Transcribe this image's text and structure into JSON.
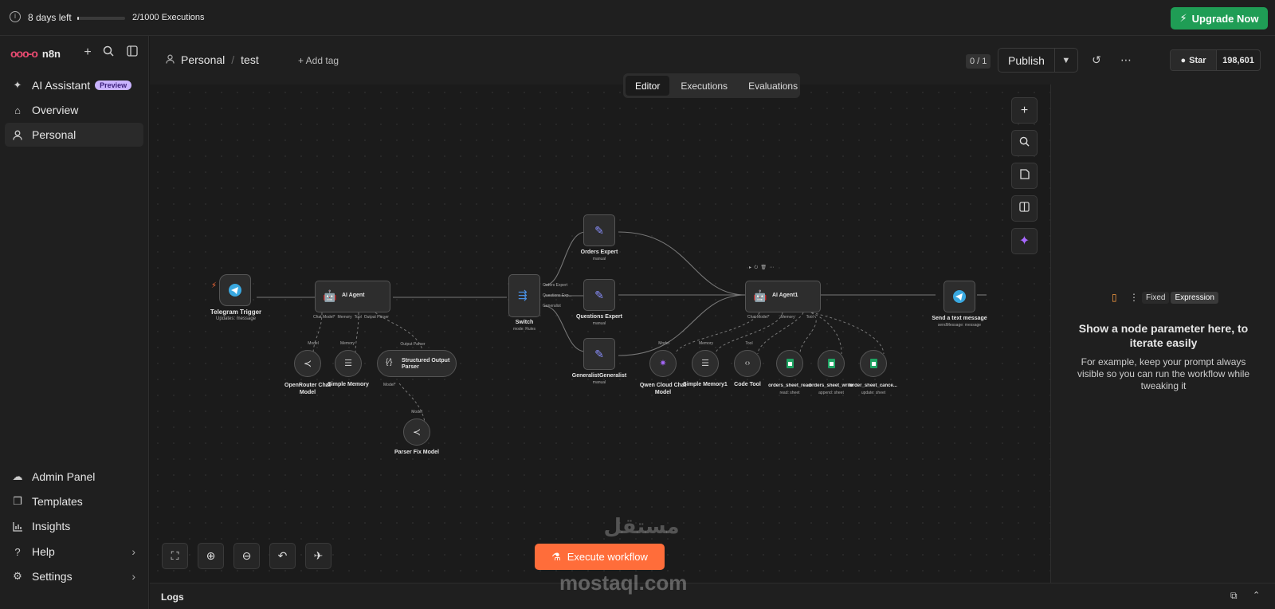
{
  "trial": {
    "days_left": "8 days left",
    "executions": "2/1000 Executions",
    "progress": 0.002
  },
  "upgrade_label": "Upgrade Now",
  "app_name": "n8n",
  "nav": {
    "ai_assistant": "AI Assistant",
    "preview_badge": "Preview",
    "overview": "Overview",
    "personal": "Personal",
    "admin_panel": "Admin Panel",
    "templates": "Templates",
    "insights": "Insights",
    "help": "Help",
    "settings": "Settings"
  },
  "breadcrumb": {
    "project": "Personal",
    "workflow": "test"
  },
  "add_tag": "+ Add tag",
  "tabs": {
    "editor": "Editor",
    "executions": "Executions",
    "evaluations": "Evaluations"
  },
  "version_counter": "0 / 1",
  "publish_label": "Publish",
  "github": {
    "star": "Star",
    "count": "198,601"
  },
  "execute_label": "Execute workflow",
  "logs_label": "Logs",
  "right_panel": {
    "fixed": "Fixed",
    "expression": "Expression",
    "title": "Show a node parameter here, to iterate easily",
    "body": "For example, keep your prompt always visible so you can run the workflow while tweaking it"
  },
  "watermark": {
    "arabic": "مستقل",
    "latin": "mostaql.com"
  },
  "nodes": {
    "telegram_trigger": {
      "title": "Telegram Trigger",
      "sub": "Updates: message"
    },
    "ai_agent": {
      "title": "AI Agent",
      "ports": [
        "Chat Model*",
        "Memory",
        "Tool",
        "Output Parser"
      ]
    },
    "openrouter": {
      "title": "OpenRouter Chat Model",
      "port": "Model"
    },
    "simple_memory": {
      "title": "Simple Memory",
      "port": "Memory"
    },
    "structured_parser": {
      "title": "Structured Output Parser",
      "port_in": "Output Parser",
      "port_out": "Model*"
    },
    "parser_fix": {
      "title": "Parser Fix Model",
      "port": "Model"
    },
    "switch": {
      "title": "Switch",
      "sub": "mode: Rules",
      "outputs": [
        "Orders Expert",
        "Questions Exp...",
        "Generalist"
      ]
    },
    "orders_expert": {
      "title": "Orders Expert",
      "sub": "manual"
    },
    "questions_expert": {
      "title": "Questions Expert",
      "sub": "manual"
    },
    "generalist": {
      "title": "GeneralistGeneralist",
      "sub": "manual"
    },
    "ai_agent1": {
      "title": "AI Agent1",
      "ports": [
        "Chat Model*",
        "Memory",
        "Tool"
      ]
    },
    "qwen": {
      "title": "Qwen Cloud Chat Model",
      "port": "Model"
    },
    "simple_memory1": {
      "title": "Simple Memory1",
      "port": "Memory"
    },
    "code_tool": {
      "title": "Code Tool",
      "port": "Tool"
    },
    "orders_sheet_read": {
      "title": "orders_sheet_read",
      "sub": "read: sheet"
    },
    "orders_sheet_write": {
      "title": "orders_sheet_write",
      "sub": "append: sheet"
    },
    "order_sheet_cancel": {
      "title": "order_sheet_cance...",
      "sub": "update: sheet"
    },
    "send_message": {
      "title": "Send a text message",
      "sub": "sendMessage: message"
    }
  }
}
